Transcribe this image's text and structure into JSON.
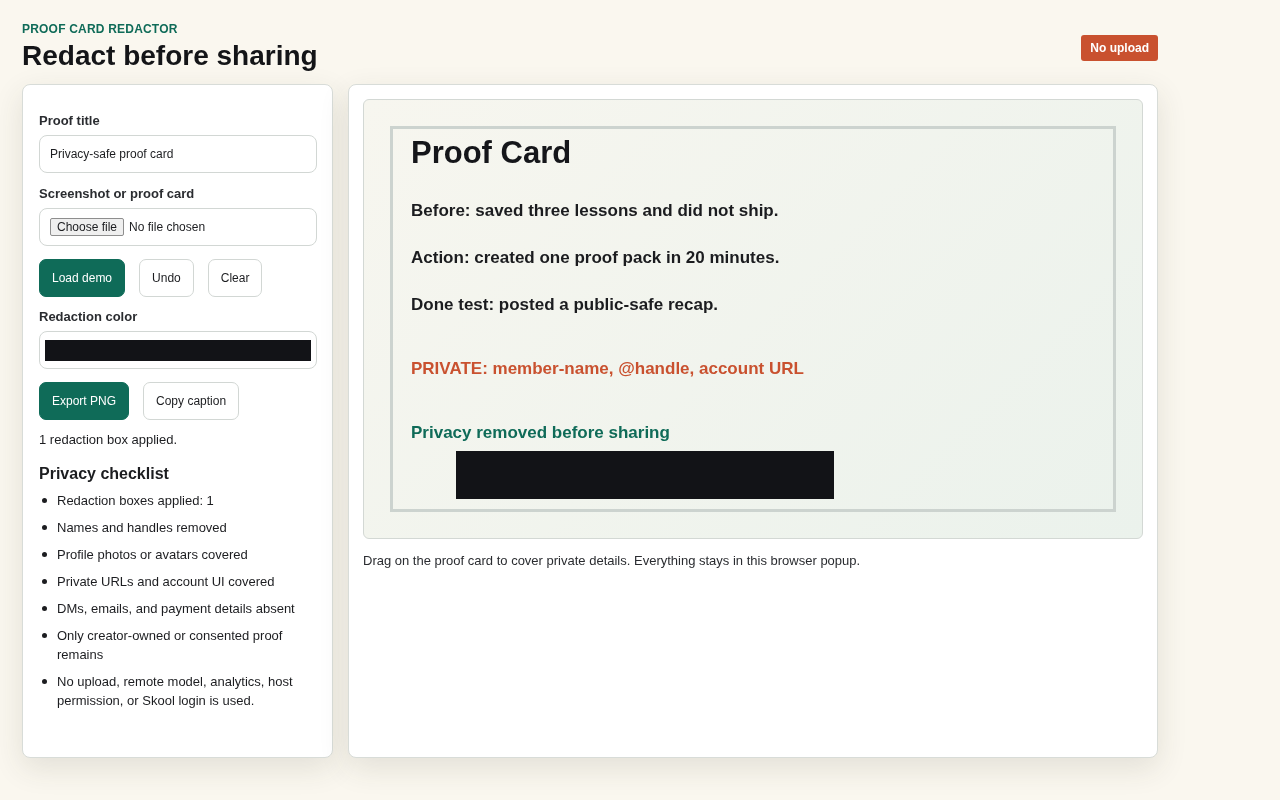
{
  "header": {
    "eyebrow": "PROOF CARD REDACTOR",
    "title": "Redact before sharing",
    "badge": "No upload"
  },
  "form": {
    "title_field": {
      "label": "Proof title",
      "value": "Privacy-safe proof card"
    },
    "file_field": {
      "label": "Screenshot or proof card",
      "button": "Choose file",
      "status": "No file chosen"
    },
    "actions": [
      {
        "label": "Load demo",
        "kind": "primary"
      },
      {
        "label": "Undo",
        "kind": "secondary"
      },
      {
        "label": "Clear",
        "kind": "secondary"
      }
    ],
    "color_field": {
      "label": "Redaction color",
      "color": "#121317"
    },
    "export_actions": [
      {
        "label": "Export PNG",
        "kind": "primary"
      },
      {
        "label": "Copy caption",
        "kind": "secondary"
      }
    ],
    "status": "1 redaction box applied.",
    "checklist": {
      "title": "Privacy checklist",
      "items": [
        "Redaction boxes applied: 1",
        "Names and handles removed",
        "Profile photos or avatars covered",
        "Private URLs and account UI covered",
        "DMs, emails, and payment details absent",
        "Only creator-owned or consented proof remains",
        "No upload, remote model, analytics, host permission, or Skool login is used."
      ]
    }
  },
  "preview": {
    "card": {
      "title": "Proof Card",
      "lines": [
        {
          "text": "Before: saved three lessons and did not ship.",
          "kind": "normal"
        },
        {
          "text": "Action: created one proof pack in 20 minutes.",
          "kind": "normal"
        },
        {
          "text": "Done test: posted a public-safe recap.",
          "kind": "normal"
        },
        {
          "text": "PRIVATE: member-name, @handle, account URL",
          "kind": "private"
        },
        {
          "text": "Privacy removed before sharing",
          "kind": "safe"
        }
      ]
    },
    "hint": "Drag on the proof card to cover private details. Everything stays in this browser popup."
  }
}
